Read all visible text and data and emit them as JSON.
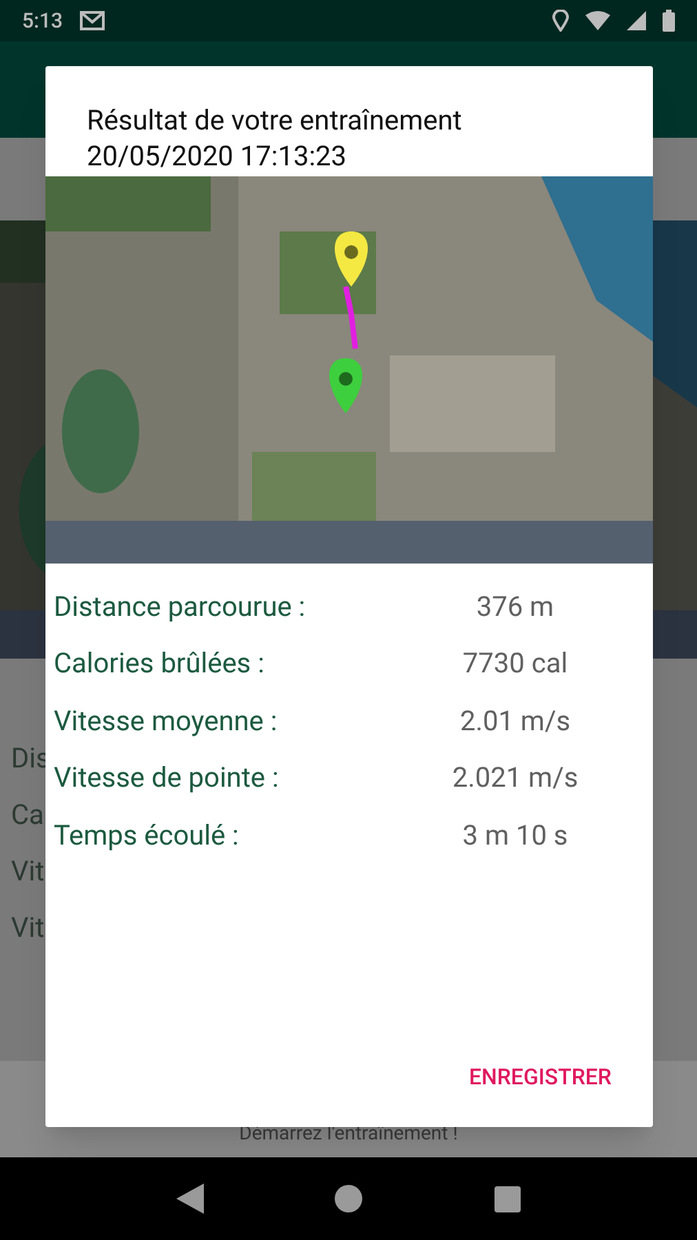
{
  "status_bar": {
    "time": "5:13"
  },
  "background": {
    "rows": [
      "Dis",
      "Ca",
      "Vit",
      "Vit"
    ],
    "footer": "Démarrez l'entraînement !"
  },
  "dialog": {
    "title": "Résultat de votre entraînement",
    "subtitle": "20/05/2020 17:13:23",
    "stats": [
      {
        "label": "Distance parcourue :",
        "value": "376 m"
      },
      {
        "label": "Calories brûlées :",
        "value": "7730 cal"
      },
      {
        "label": "Vitesse moyenne :",
        "value": "2.01 m/s"
      },
      {
        "label": "Vitesse de pointe :",
        "value": "2.021 m/s"
      },
      {
        "label": "Temps écoulé :",
        "value": "3 m 10 s"
      }
    ],
    "button": "ENREGISTRER"
  }
}
